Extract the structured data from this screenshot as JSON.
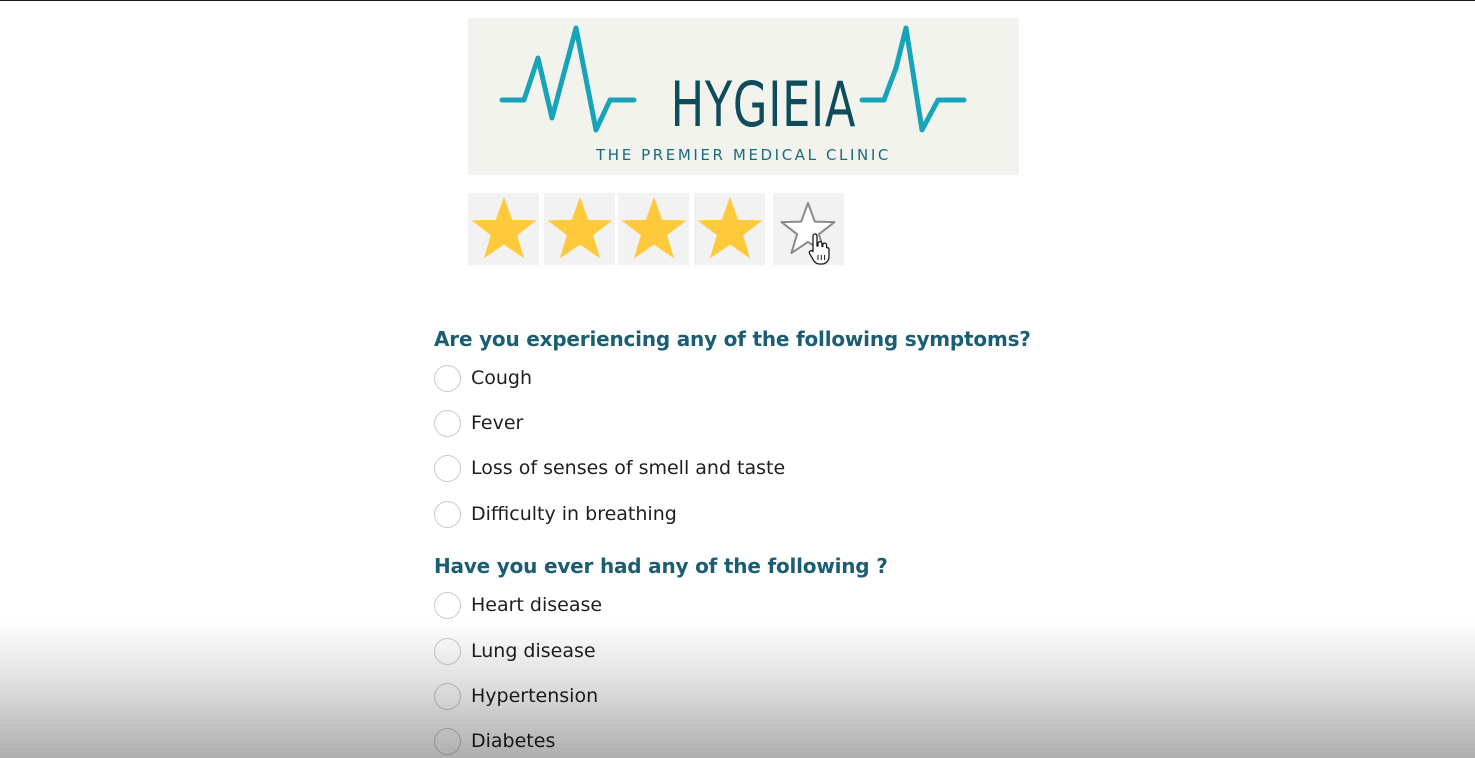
{
  "logo": {
    "name": "HYGIEIA",
    "tagline": "THE PREMIER MEDICAL CLINIC",
    "colors": {
      "background": "#f3f3ee",
      "wordmark": "#0e4c5c",
      "heartbeat": "#17a3b8",
      "tagline": "#1a6b7c"
    }
  },
  "rating": {
    "max": 5,
    "value": 4,
    "filled_color": "#ffc93c",
    "empty_outline_color": "#8a8a8a",
    "tile_color": "#f2f2f2"
  },
  "sections": [
    {
      "question": "Are you experiencing any of the following symptoms?",
      "options": [
        "Cough",
        "Fever",
        "Loss of senses of smell and taste",
        "Difficulty in breathing"
      ]
    },
    {
      "question": "Have you ever had any of the following ?",
      "options": [
        "Heart disease",
        "Lung disease",
        "Hypertension",
        "Diabetes"
      ]
    }
  ],
  "colors": {
    "question": "#1b5e73",
    "option_text": "#1e1e1e",
    "radio_border": "#c9c9c9"
  }
}
